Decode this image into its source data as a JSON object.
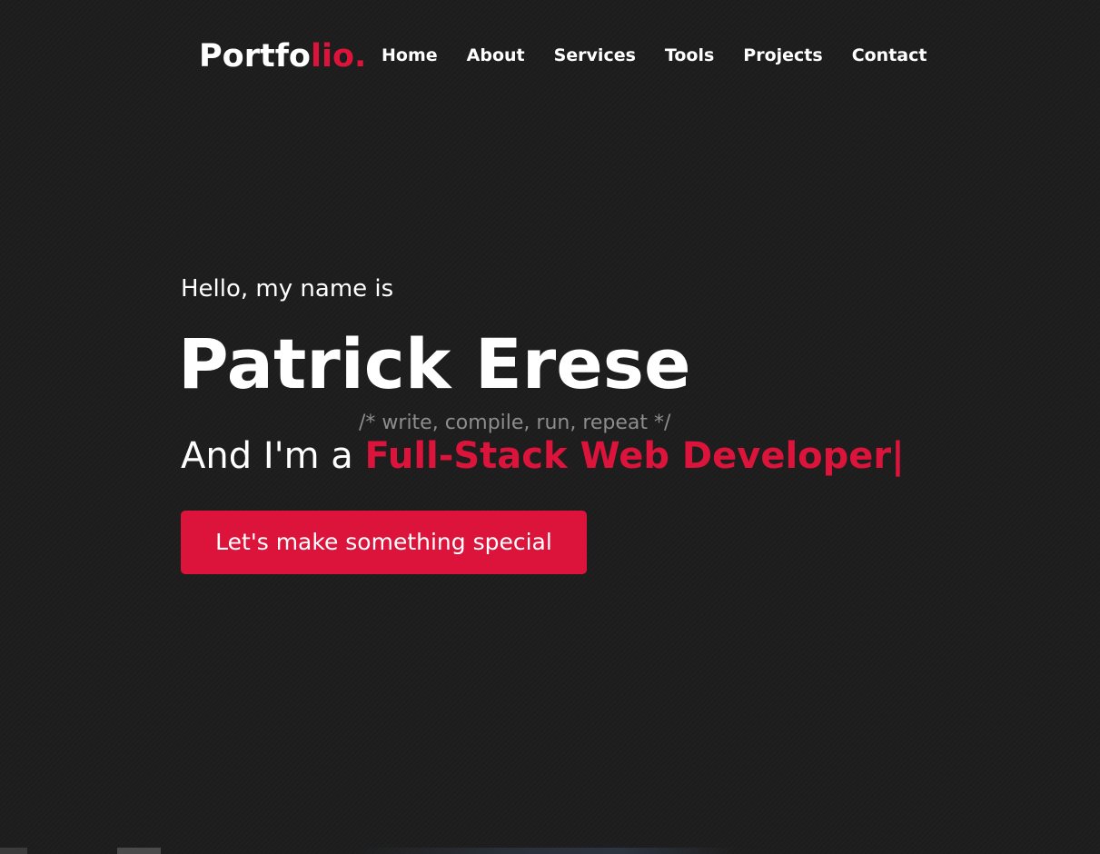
{
  "logo": {
    "text_main": "Portfo",
    "text_accent": "lio."
  },
  "nav": {
    "items": [
      {
        "label": "Home"
      },
      {
        "label": "About"
      },
      {
        "label": "Services"
      },
      {
        "label": "Tools"
      },
      {
        "label": "Projects"
      },
      {
        "label": "Contact"
      }
    ]
  },
  "hero": {
    "greeting": "Hello, my name is",
    "name": "Patrick Erese",
    "comment": "/* write, compile, run, repeat */",
    "role_prefix": "And I'm a ",
    "role": "Full-Stack Web Developer|",
    "cta_label": "Let's make something special"
  },
  "colors": {
    "accent": "#dc143c",
    "background": "#1d1d1d",
    "text": "#ffffff",
    "comment": "#8d8d8d"
  }
}
